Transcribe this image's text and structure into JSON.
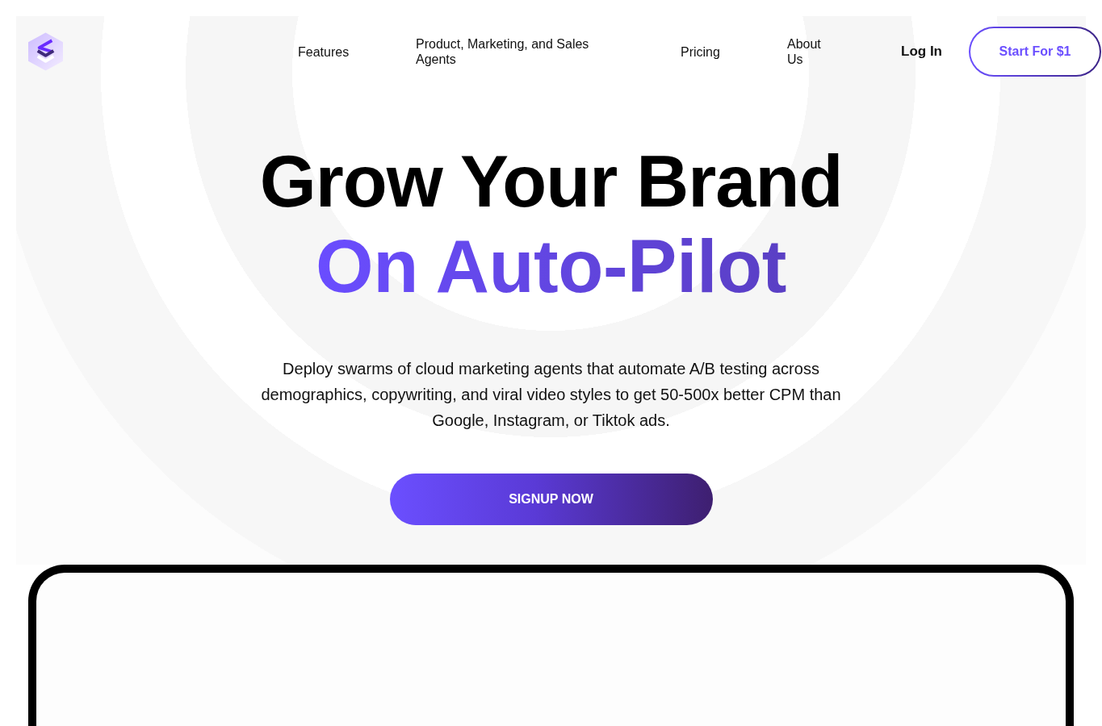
{
  "nav": {
    "links": [
      "Features",
      "Product, Marketing, and Sales Agents",
      "Pricing",
      "About Us"
    ],
    "login": "Log In",
    "cta": "Start For $1"
  },
  "hero": {
    "title": "Grow Your Brand",
    "title_accent": "On Auto-Pilot",
    "description": "Deploy swarms of cloud marketing agents that automate A/B testing across demographics, copywriting, and viral video styles to get 50-500x better CPM than Google, Instagram, or Tiktok ads.",
    "button": "SIGNUP NOW"
  }
}
